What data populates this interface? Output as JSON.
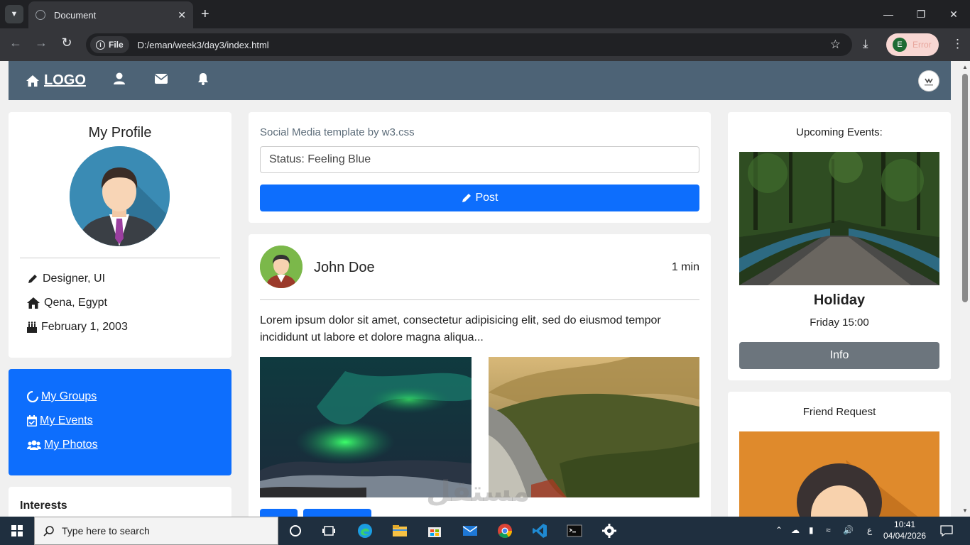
{
  "browser": {
    "tab_title": "Document",
    "url_chip": "File",
    "url": "D:/eman/week3/day3/index.html",
    "profile_initial": "E",
    "profile_status": "Error"
  },
  "nav": {
    "logo": "LOGO"
  },
  "profile": {
    "title": "My Profile",
    "job": "Designer, UI",
    "location": "Qena, Egypt",
    "birthday": "February 1, 2003"
  },
  "links": {
    "groups": " My Groups",
    "events": "My Events",
    "photos": " My Photos"
  },
  "interests": {
    "title": "Interests"
  },
  "composer": {
    "heading": "Social Media template by w3.css",
    "status_value": "Status: Feeling Blue",
    "post_label": "Post"
  },
  "feed": {
    "author": "John Doe",
    "time": "1 min",
    "text": "Lorem ipsum dolor sit amet, consectetur adipisicing elit, sed do eiusmod tempor incididunt ut labore et dolore magna aliqua..."
  },
  "events": {
    "heading": "Upcoming Events:",
    "name": "Holiday",
    "when": "Friday 15:00",
    "info_label": "Info"
  },
  "friends": {
    "heading": "Friend Request"
  },
  "taskbar": {
    "search_placeholder": "Type here to search",
    "lang": "ع",
    "time": "10:41",
    "date": "04/04/2026"
  },
  "watermark": "مستقل",
  "colors": {
    "nav": "#4d6376",
    "primary": "#0d6efd",
    "secondary": "#6c757d",
    "page_bg": "#f0f0f0"
  }
}
